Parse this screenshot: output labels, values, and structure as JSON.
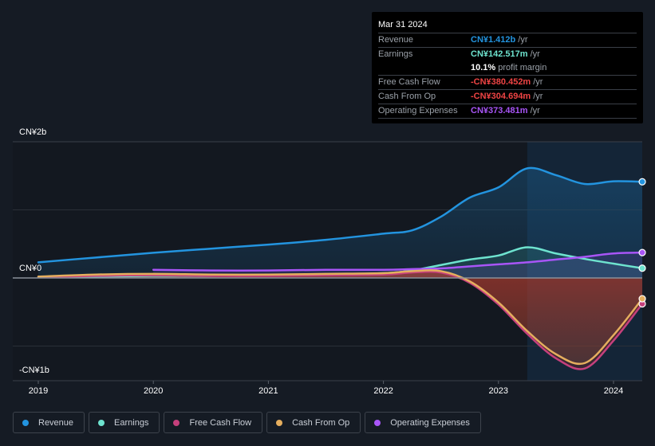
{
  "tooltip": {
    "date": "Mar 31 2024",
    "rows": [
      {
        "label": "Revenue",
        "value": "CN¥1.412b",
        "unit": "/yr",
        "color": "#2394df"
      },
      {
        "label": "Earnings",
        "value": "CN¥142.517m",
        "unit": "/yr",
        "color": "#6ee3cf"
      },
      {
        "label": "",
        "value": "10.1%",
        "unit": "profit margin",
        "color": "#ffffff"
      },
      {
        "label": "Free Cash Flow",
        "value": "-CN¥380.452m",
        "unit": "/yr",
        "color": "#ef4444"
      },
      {
        "label": "Cash From Op",
        "value": "-CN¥304.694m",
        "unit": "/yr",
        "color": "#ef4444"
      },
      {
        "label": "Operating Expenses",
        "value": "CN¥373.481m",
        "unit": "/yr",
        "color": "#a855f7"
      }
    ]
  },
  "legend": [
    {
      "label": "Revenue",
      "color": "#2394df"
    },
    {
      "label": "Earnings",
      "color": "#6ee3cf"
    },
    {
      "label": "Free Cash Flow",
      "color": "#c5407c"
    },
    {
      "label": "Cash From Op",
      "color": "#e5ae5e"
    },
    {
      "label": "Operating Expenses",
      "color": "#a855f7"
    }
  ],
  "chart_data": {
    "type": "line",
    "title": "",
    "xlabel": "",
    "ylabel": "",
    "unit": "CN¥ billions",
    "y_ticks": [
      {
        "value": 2,
        "label": "CN¥2b"
      },
      {
        "value": 0,
        "label": "CN¥0"
      },
      {
        "value": -1,
        "label": "-CN¥1b"
      }
    ],
    "x_ticks": [
      {
        "value": 2019,
        "label": "2019"
      },
      {
        "value": 2020,
        "label": "2020"
      },
      {
        "value": 2021,
        "label": "2021"
      },
      {
        "value": 2022,
        "label": "2022"
      },
      {
        "value": 2023,
        "label": "2023"
      },
      {
        "value": 2024,
        "label": "2024"
      }
    ],
    "xlim": [
      2019,
      2024.25
    ],
    "ylim": [
      -1.0,
      2.0
    ],
    "highlight_range": [
      2023.25,
      2024.25
    ],
    "grid": true,
    "legend_position": "bottom",
    "series": [
      {
        "name": "Revenue",
        "color": "#2394df",
        "x": [
          2019.0,
          2019.5,
          2020.0,
          2020.5,
          2021.0,
          2021.5,
          2022.0,
          2022.25,
          2022.5,
          2022.75,
          2023.0,
          2023.25,
          2023.5,
          2023.75,
          2024.0,
          2024.25
        ],
        "y": [
          0.23,
          0.3,
          0.37,
          0.43,
          0.49,
          0.56,
          0.65,
          0.7,
          0.9,
          1.18,
          1.33,
          1.61,
          1.51,
          1.38,
          1.42,
          1.412
        ]
      },
      {
        "name": "Earnings",
        "color": "#6ee3cf",
        "x": [
          2019.0,
          2019.5,
          2020.0,
          2020.5,
          2021.0,
          2021.5,
          2022.0,
          2022.25,
          2022.5,
          2022.75,
          2023.0,
          2023.25,
          2023.5,
          2023.75,
          2024.0,
          2024.25
        ],
        "y": [
          0.01,
          0.02,
          0.03,
          0.03,
          0.04,
          0.05,
          0.07,
          0.11,
          0.19,
          0.27,
          0.33,
          0.45,
          0.36,
          0.28,
          0.21,
          0.143
        ]
      },
      {
        "name": "Free Cash Flow",
        "color": "#c5407c",
        "x": [
          2019.0,
          2019.5,
          2020.0,
          2020.5,
          2021.0,
          2021.5,
          2022.0,
          2022.25,
          2022.5,
          2022.75,
          2023.0,
          2023.25,
          2023.5,
          2023.75,
          2024.0,
          2024.25
        ],
        "y": [
          0.01,
          0.03,
          0.04,
          0.03,
          0.03,
          0.04,
          0.05,
          0.08,
          0.08,
          -0.07,
          -0.39,
          -0.82,
          -1.18,
          -1.33,
          -0.92,
          -0.38
        ]
      },
      {
        "name": "Cash From Op",
        "color": "#e5ae5e",
        "x": [
          2019.0,
          2019.5,
          2020.0,
          2020.5,
          2021.0,
          2021.5,
          2022.0,
          2022.25,
          2022.5,
          2022.75,
          2023.0,
          2023.25,
          2023.5,
          2023.75,
          2024.0,
          2024.25
        ],
        "y": [
          0.02,
          0.05,
          0.06,
          0.05,
          0.05,
          0.06,
          0.07,
          0.1,
          0.1,
          -0.05,
          -0.36,
          -0.78,
          -1.12,
          -1.25,
          -0.84,
          -0.305
        ]
      },
      {
        "name": "Operating Expenses",
        "color": "#a855f7",
        "x": [
          2020.0,
          2020.5,
          2021.0,
          2021.5,
          2022.0,
          2022.25,
          2022.5,
          2022.75,
          2023.0,
          2023.25,
          2023.5,
          2023.75,
          2024.0,
          2024.25
        ],
        "y": [
          0.12,
          0.11,
          0.11,
          0.12,
          0.12,
          0.13,
          0.14,
          0.17,
          0.2,
          0.23,
          0.27,
          0.31,
          0.36,
          0.373
        ]
      }
    ]
  }
}
